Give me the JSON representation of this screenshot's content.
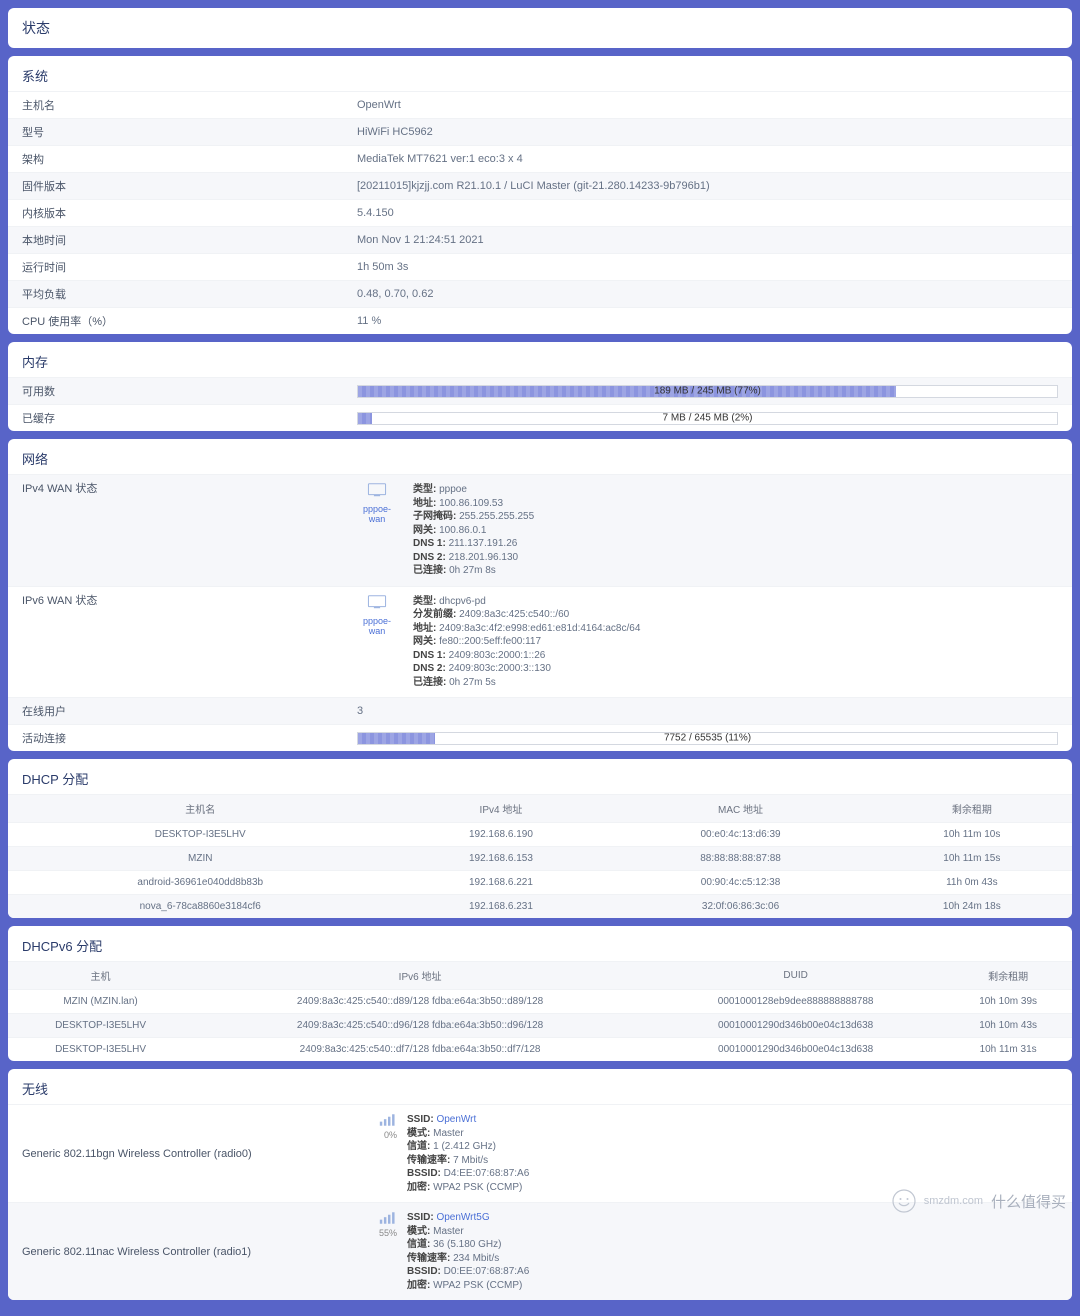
{
  "page_title": "状态",
  "system": {
    "title": "系统",
    "rows": [
      {
        "label": "主机名",
        "value": "OpenWrt"
      },
      {
        "label": "型号",
        "value": "HiWiFi HC5962"
      },
      {
        "label": "架构",
        "value": "MediaTek MT7621 ver:1 eco:3 x 4"
      },
      {
        "label": "固件版本",
        "value": "[20211015]kjzjj.com R21.10.1 / LuCI Master (git-21.280.14233-9b796b1)"
      },
      {
        "label": "内核版本",
        "value": "5.4.150"
      },
      {
        "label": "本地时间",
        "value": "Mon Nov 1 21:24:51 2021"
      },
      {
        "label": "运行时间",
        "value": "1h 50m 3s"
      },
      {
        "label": "平均负载",
        "value": "0.48, 0.70, 0.62"
      },
      {
        "label": "CPU 使用率（%）",
        "value": "11 %"
      }
    ]
  },
  "memory": {
    "title": "内存",
    "available": {
      "label": "可用数",
      "text": "189 MB / 245 MB (77%)",
      "percent": 77
    },
    "cached": {
      "label": "已缓存",
      "text": "7 MB / 245 MB (2%)",
      "percent": 2
    }
  },
  "network": {
    "title": "网络",
    "ipv4": {
      "label": "IPv4 WAN 状态",
      "iface": "pppoe-wan",
      "lines": [
        [
          "类型:",
          "pppoe"
        ],
        [
          "地址:",
          "100.86.109.53"
        ],
        [
          "子网掩码:",
          "255.255.255.255"
        ],
        [
          "网关:",
          "100.86.0.1"
        ],
        [
          "DNS 1:",
          "211.137.191.26"
        ],
        [
          "DNS 2:",
          "218.201.96.130"
        ],
        [
          "已连接:",
          "0h 27m 8s"
        ]
      ]
    },
    "ipv6": {
      "label": "IPv6 WAN 状态",
      "iface": "pppoe-wan",
      "lines": [
        [
          "类型:",
          "dhcpv6-pd"
        ],
        [
          "分发前缀:",
          "2409:8a3c:425:c540::/60"
        ],
        [
          "地址:",
          "2409:8a3c:4f2:e998:ed61:e81d:4164:ac8c/64"
        ],
        [
          "网关:",
          "fe80::200:5eff:fe00:117"
        ],
        [
          "DNS 1:",
          "2409:803c:2000:1::26"
        ],
        [
          "DNS 2:",
          "2409:803c:2000:3::130"
        ],
        [
          "已连接:",
          "0h 27m 5s"
        ]
      ]
    },
    "online_users": {
      "label": "在线用户",
      "value": "3"
    },
    "active_conn": {
      "label": "活动连接",
      "text": "7752 / 65535 (11%)",
      "percent": 11
    }
  },
  "dhcp4": {
    "title": "DHCP 分配",
    "columns": [
      "主机名",
      "IPv4 地址",
      "MAC 地址",
      "剩余租期"
    ],
    "rows": [
      [
        "DESKTOP-I3E5LHV",
        "192.168.6.190",
        "00:e0:4c:13:d6:39",
        "10h 11m 10s"
      ],
      [
        "MZIN",
        "192.168.6.153",
        "88:88:88:88:87:88",
        "10h 11m 15s"
      ],
      [
        "android-36961e040dd8b83b",
        "192.168.6.221",
        "00:90:4c:c5:12:38",
        "11h 0m 43s"
      ],
      [
        "nova_6-78ca8860e3184cf6",
        "192.168.6.231",
        "32:0f:06:86:3c:06",
        "10h 24m 18s"
      ]
    ]
  },
  "dhcp6": {
    "title": "DHCPv6 分配",
    "columns": [
      "主机",
      "IPv6 地址",
      "DUID",
      "剩余租期"
    ],
    "rows": [
      [
        "MZIN (MZIN.lan)",
        "2409:8a3c:425:c540::d89/128 fdba:e64a:3b50::d89/128",
        "0001000128eb9dee888888888788",
        "10h 10m 39s"
      ],
      [
        "DESKTOP-I3E5LHV",
        "2409:8a3c:425:c540::d96/128 fdba:e64a:3b50::d96/128",
        "00010001290d346b00e04c13d638",
        "10h 10m 43s"
      ],
      [
        "DESKTOP-I3E5LHV",
        "2409:8a3c:425:c540::df7/128 fdba:e64a:3b50::df7/128",
        "00010001290d346b00e04c13d638",
        "10h 11m 31s"
      ]
    ]
  },
  "wireless": {
    "title": "无线",
    "radios": [
      {
        "label": "Generic 802.11bgn Wireless Controller (radio0)",
        "pct": "0%",
        "ssid": "OpenWrt",
        "lines": [
          [
            "模式:",
            "Master"
          ],
          [
            "信道:",
            "1 (2.412 GHz)"
          ],
          [
            "传输速率:",
            "7 Mbit/s"
          ],
          [
            "BSSID:",
            "D4:EE:07:68:87:A6"
          ],
          [
            "加密:",
            "WPA2 PSK (CCMP)"
          ]
        ]
      },
      {
        "label": "Generic 802.11nac Wireless Controller (radio1)",
        "pct": "55%",
        "ssid": "OpenWrt5G",
        "lines": [
          [
            "模式:",
            "Master"
          ],
          [
            "信道:",
            "36 (5.180 GHz)"
          ],
          [
            "传输速率:",
            "234 Mbit/s"
          ],
          [
            "BSSID:",
            "D0:EE:07:68:87:A6"
          ],
          [
            "加密:",
            "WPA2 PSK (CCMP)"
          ]
        ]
      }
    ]
  },
  "watermark": {
    "brand": "smzdm.com",
    "cn": "什么值得买"
  }
}
